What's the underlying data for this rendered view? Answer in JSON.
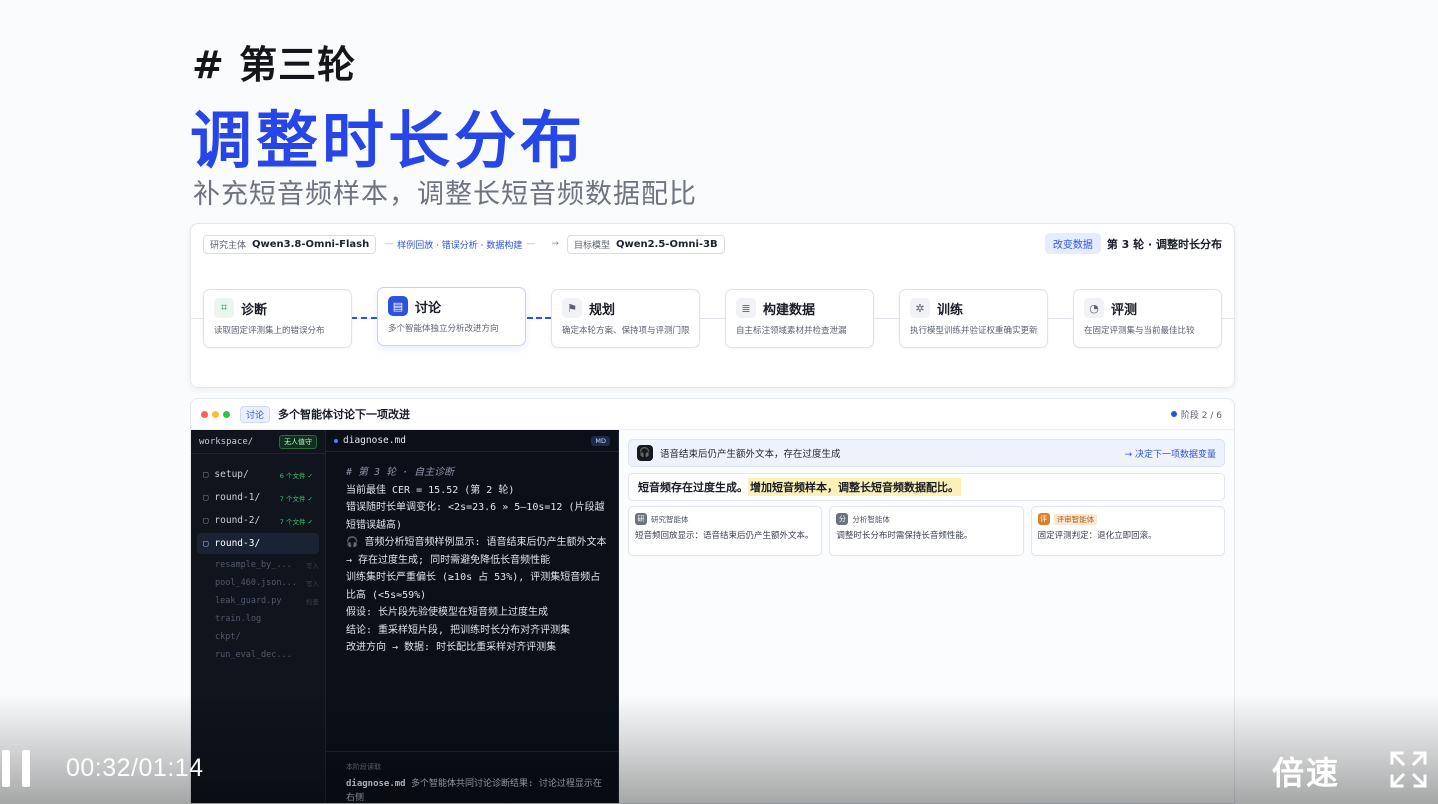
{
  "header": {
    "kicker": "# 第三轮",
    "title": "调整时长分布",
    "subtitle": "补充短音频样本，调整长短音频数据配比"
  },
  "pipeline": {
    "researcher_label": "研究主体",
    "researcher_model": "Qwen3.8-Omni-Flash",
    "flow_text": "样例回放 · 错误分析 · 数据构建",
    "target_label": "目标模型",
    "target_model": "Qwen2.5-Omni-3B",
    "badge": "改变数据",
    "round_label": "第 3 轮 · 调整时长分布",
    "steps": [
      {
        "title": "诊断",
        "desc": "读取固定评测集上的错误分布"
      },
      {
        "title": "讨论",
        "desc": "多个智能体独立分析改进方向"
      },
      {
        "title": "规划",
        "desc": "确定本轮方案、保持项与评测门限"
      },
      {
        "title": "构建数据",
        "desc": "自主标注领域素材并检查泄漏"
      },
      {
        "title": "训练",
        "desc": "执行模型训练并验证权重确实更新"
      },
      {
        "title": "评测",
        "desc": "在固定评测集与当前最佳比较"
      }
    ]
  },
  "window": {
    "tag": "讨论",
    "title": "多个智能体讨论下一项改进",
    "stage": "阶段 2 / 6"
  },
  "sidebar": {
    "root": "workspace/",
    "badge": "无人值守",
    "folders": [
      {
        "name": "setup/",
        "count": "6 个文件 ✓"
      },
      {
        "name": "round-1/",
        "count": "7 个文件 ✓"
      },
      {
        "name": "round-2/",
        "count": "7 个文件 ✓"
      },
      {
        "name": "round-3/",
        "count": ""
      }
    ],
    "files": [
      {
        "name": "resample_by_...",
        "tag": "写入"
      },
      {
        "name": "pool_460.json...",
        "tag": "写入"
      },
      {
        "name": "leak_guard.py",
        "tag": "检查"
      },
      {
        "name": "train.log",
        "tag": ""
      },
      {
        "name": "ckpt/",
        "tag": ""
      },
      {
        "name": "run_eval_dec...",
        "tag": ""
      }
    ]
  },
  "editor": {
    "filename": "diagnose.md",
    "badge": "MD",
    "lines": [
      "# 第 3 轮 · 自主诊断",
      "当前最佳 CER = 15.52 (第 2 轮)",
      "错误随时长单调变化: <2s=23.6 » 5–10s=12 (片段越短错误越高)",
      "🎧 音频分析短音频样例显示: 语音结束后仍产生额外文本 → 存在过度生成; 同时需避免降低长音频性能",
      "训练集时长严重偏长 (≥10s 占 53%), 评测集短音频占比高 (<5s≈59%)",
      "假设: 长片段先验使模型在短音频上过度生成",
      "结论: 重采样短片段, 把训练时长分布对齐评测集",
      "改进方向 → 数据: 时长配比重采样对齐评测集"
    ],
    "foot_label": "本阶段读取",
    "foot_file": "diagnose.md",
    "foot_text": "多个智能体共同讨论诊断结果: 讨论过程显示在右侧"
  },
  "discussion": {
    "question": "语音结束后仍产生额外文本，存在过度生成",
    "decision": "决定下一项数据变量",
    "conclusion_plain": "短音频存在过度生成。",
    "conclusion_highlight": "增加短音频样本，调整长短音频数据配比。",
    "agents": [
      {
        "name": "研究智能体",
        "avatar": "研",
        "text": "短音频回放显示：语音结束后仍产生额外文本。"
      },
      {
        "name": "分析智能体",
        "avatar": "分",
        "text": "调整时长分布时需保持长音频性能。"
      },
      {
        "name": "评审智能体",
        "avatar": "评",
        "text": "固定评测判定：退化立即回滚。"
      }
    ]
  },
  "player": {
    "timecode": "00:32/01:14",
    "speed_label": "倍速"
  },
  "colors": {
    "accent": "#2646e8",
    "link": "#2d52e0",
    "highlight": "#fbf0b8",
    "dark_panel": "#0f141d"
  }
}
